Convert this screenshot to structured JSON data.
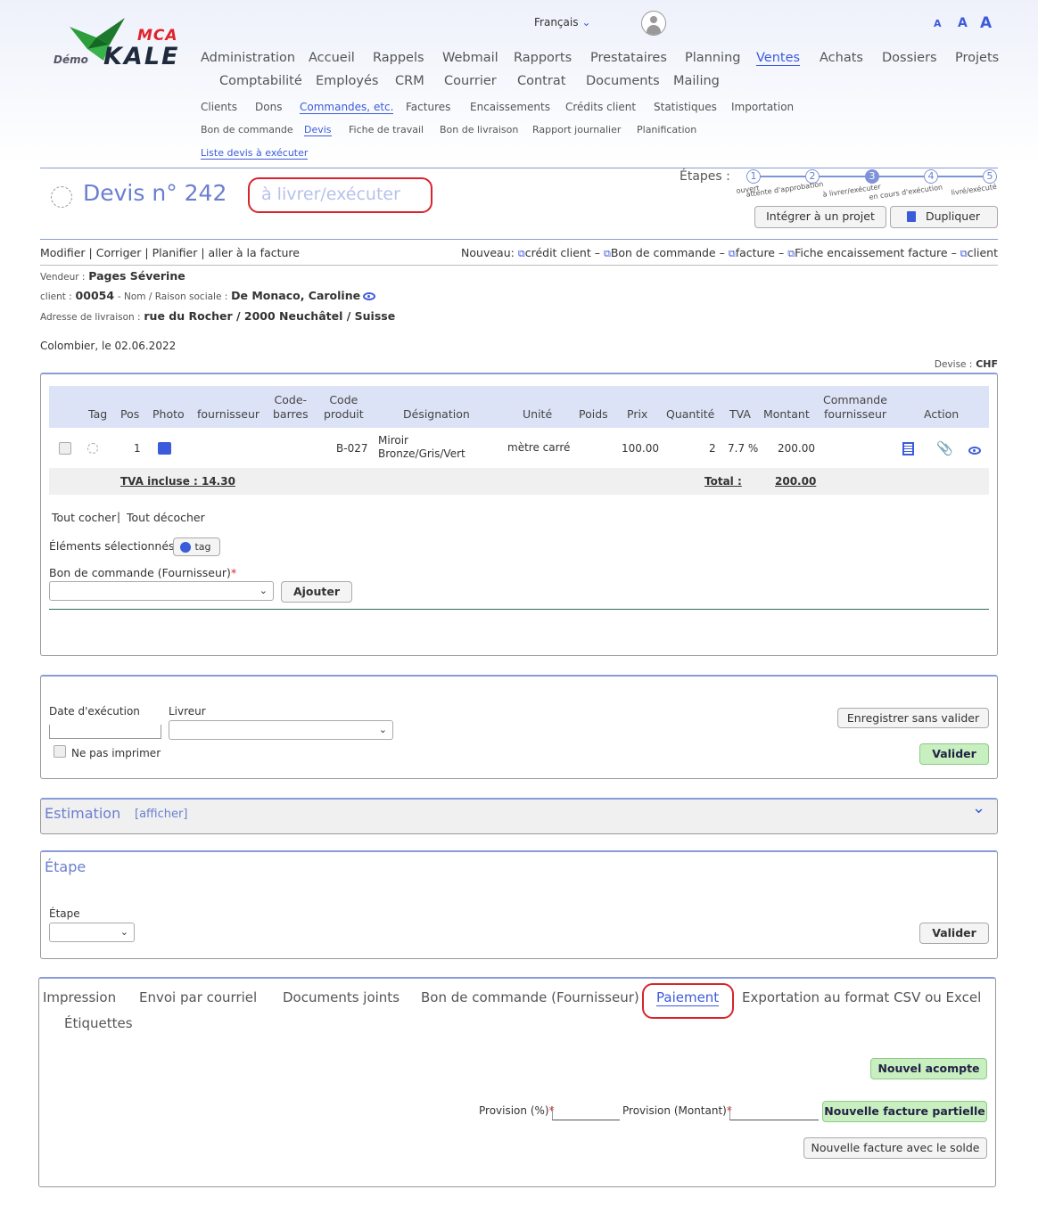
{
  "header": {
    "logo": {
      "mca": "MCA",
      "kale": "KALE",
      "demo": "Démo"
    },
    "language": "Français",
    "font_sizes": [
      "A",
      "A",
      "A"
    ],
    "nav_main": [
      "Administration",
      "Accueil",
      "Rappels",
      "Webmail",
      "Rapports",
      "Prestataires",
      "Planning",
      "Ventes",
      "Achats",
      "Dossiers",
      "Projets"
    ],
    "nav_second": [
      "Comptabilité",
      "Employés",
      "CRM",
      "Courrier",
      "Contrat",
      "Documents",
      "Mailing"
    ],
    "sub1": [
      "Clients",
      "Dons",
      "Commandes, etc.",
      "Factures",
      "Encaissements",
      "Crédits client",
      "Statistiques",
      "Importation"
    ],
    "sub2": [
      "Bon de commande",
      "Devis",
      "Fiche de travail",
      "Bon de livraison",
      "Rapport journalier",
      "Planification"
    ],
    "sub3": "Liste devis à exécuter"
  },
  "doc": {
    "title": "Devis n° 242",
    "status": "à livrer/exécuter",
    "steps_label": "Étapes :",
    "steps": [
      {
        "n": "1",
        "label": "ouvert"
      },
      {
        "n": "2",
        "label": "attente d'approbation"
      },
      {
        "n": "3",
        "label": "à livrer/exécuter"
      },
      {
        "n": "4",
        "label": "en cours d'exécution"
      },
      {
        "n": "5",
        "label": "livré/exécuté"
      }
    ],
    "btn_integrer": "Intégrer à un projet",
    "btn_dupliquer": "Dupliquer"
  },
  "actions": {
    "modifier": "Modifier",
    "corriger": "Corriger",
    "planifier": "Planifier",
    "aller": "aller à la facture"
  },
  "nouveau": {
    "label": "Nouveau:",
    "items": [
      "crédit client",
      "Bon de commande",
      "facture",
      "Fiche encaissement facture",
      "client"
    ]
  },
  "info": {
    "vendeur_lbl": "Vendeur :",
    "vendeur": "Pages Séverine",
    "client_lbl": "client :",
    "client_no": "00054",
    "nom_lbl": "- Nom / Raison sociale :",
    "client_name": "De Monaco, Caroline",
    "adresse_lbl": "Adresse de livraison :",
    "adresse": "rue du Rocher / 2000 Neuchâtel / Suisse",
    "place_date": "Colombier, le 02.06.2022",
    "devise_lbl": "Devise :",
    "devise": "CHF"
  },
  "table": {
    "headers": {
      "tag": "Tag",
      "pos": "Pos",
      "photo": "Photo",
      "fournisseur": "fournisseur",
      "codebarres": "Code-\nbarres",
      "codeproduit": "Code\nproduit",
      "designation": "Désignation",
      "unite": "Unité",
      "poids": "Poids",
      "prix": "Prix",
      "quantite": "Quantité",
      "tva": "TVA",
      "montant": "Montant",
      "commande": "Commande\nfournisseur",
      "action": "Action"
    },
    "row": {
      "pos": "1",
      "code": "B-027",
      "designation": "Miroir\nBronze/Gris/Vert",
      "unite": "mètre carré",
      "prix": "100.00",
      "quantite": "2",
      "tva": "7.7 %",
      "montant": "200.00"
    },
    "tva_incluse": "TVA incluse : 14.30",
    "total_lbl": "Total :",
    "total": "200.00"
  },
  "selection": {
    "tout_cocher": "Tout cocher",
    "sep": "|",
    "tout_decocher": "Tout décocher",
    "elements": "Éléments sélectionnés:",
    "tag": "tag",
    "bon_lbl": "Bon de commande (Fournisseur)",
    "req": "*",
    "ajouter": "Ajouter"
  },
  "execution": {
    "date_lbl": "Date d'exécution",
    "livreur_lbl": "Livreur",
    "ne_pas": "Ne pas imprimer",
    "enregistrer": "Enregistrer sans valider",
    "valider": "Valider"
  },
  "estimation": {
    "title": "Estimation",
    "afficher": "[afficher]"
  },
  "etape": {
    "title": "Étape",
    "lbl": "Étape",
    "valider": "Valider"
  },
  "tabs": [
    "Impression",
    "Envoi par courriel",
    "Documents joints",
    "Bon de commande (Fournisseur)",
    "Paiement",
    "Exportation au format CSV ou Excel",
    "Étiquettes"
  ],
  "paiement": {
    "acompte": "Nouvel acompte",
    "prov_pct": "Provision (%)",
    "prov_mnt": "Provision (Montant)",
    "req": "*",
    "partielle": "Nouvelle facture partielle",
    "solde": "Nouvelle facture avec le solde"
  }
}
